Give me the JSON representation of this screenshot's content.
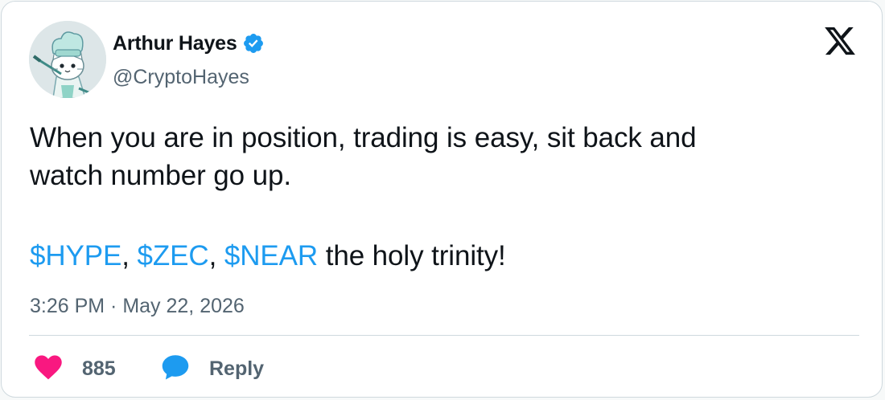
{
  "author": {
    "display_name": "Arthur Hayes",
    "handle": "@CryptoHayes",
    "verified": true
  },
  "tweet": {
    "line1": "When you are in position, trading is easy, sit back and",
    "line2": "watch number go up.",
    "cashtags": [
      "$HYPE",
      "$ZEC",
      "$NEAR"
    ],
    "separator": ", ",
    "tail": " the holy trinity!"
  },
  "timestamp": "3:26 PM · May 22, 2026",
  "actions": {
    "likes": "885",
    "reply_label": "Reply"
  },
  "icons": {
    "verified": "verified-badge-icon",
    "brand": "x-logo-icon",
    "like": "heart-icon",
    "reply": "speech-bubble-icon"
  },
  "colors": {
    "accent": "#1d9bf0",
    "like": "#f91880",
    "text": "#0f1419",
    "secondary": "#536471",
    "border": "#cfd9de"
  }
}
